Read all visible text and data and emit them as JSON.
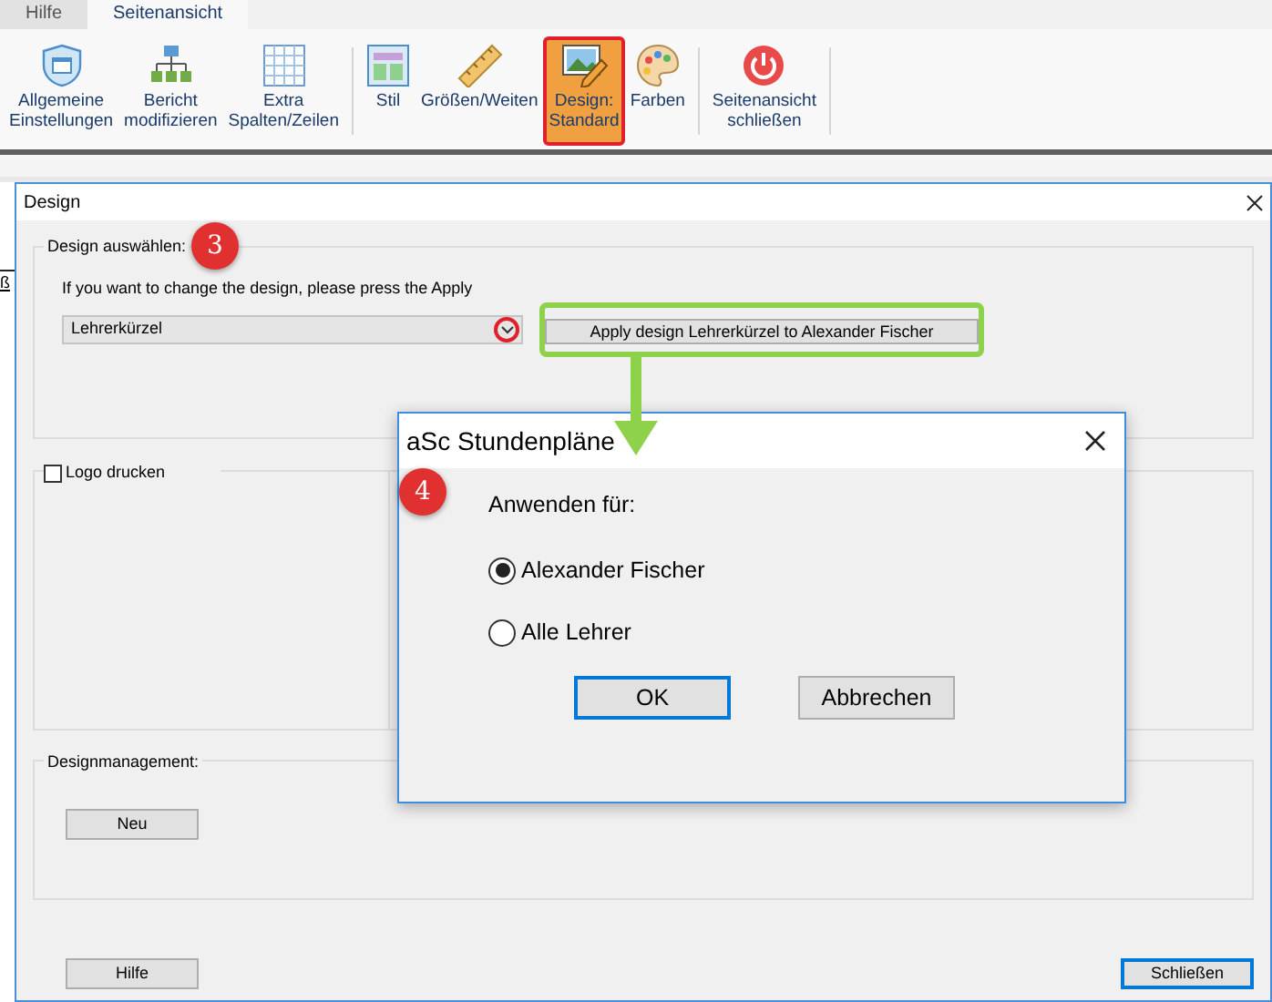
{
  "ribbon": {
    "tabs": [
      {
        "label": "Hilfe",
        "selected": false
      },
      {
        "label": "Seitenansicht",
        "selected": true
      }
    ],
    "groups": [
      [
        {
          "lines": [
            "Allgemeine",
            "Einstellungen"
          ],
          "selected": false
        },
        {
          "lines": [
            "Bericht",
            "modifizieren"
          ],
          "selected": false
        },
        {
          "lines": [
            "Extra",
            "Spalten/Zeilen"
          ],
          "selected": false
        }
      ],
      [
        {
          "lines": [
            "Stil"
          ],
          "selected": false
        },
        {
          "lines": [
            "Größen/Weiten"
          ],
          "selected": false
        },
        {
          "lines": [
            "Design:",
            "Standard"
          ],
          "selected": true
        },
        {
          "lines": [
            "Farben"
          ],
          "selected": false
        }
      ],
      [
        {
          "lines": [
            "Seitenansicht",
            "schließen"
          ],
          "selected": false
        }
      ]
    ]
  },
  "background_fragment": "ß",
  "design_window": {
    "title": "Design",
    "select_group": {
      "label": "Design auswählen:",
      "hint": "If you want to change the design, please press the Apply",
      "dropdown_value": "Lehrerkürzel",
      "apply_button": "Apply design Lehrerkürzel to Alexander Fischer"
    },
    "logo_checkbox": {
      "label": "Logo drucken",
      "checked": false
    },
    "management_group": {
      "label": "Designmanagement:",
      "new_button": "Neu"
    },
    "help_button": "Hilfe",
    "close_button": "Schließen"
  },
  "apply_dialog": {
    "title": "aSc Stundenpläne",
    "prompt": "Anwenden für:",
    "options": [
      {
        "label": "Alexander Fischer",
        "selected": true
      },
      {
        "label": "Alle Lehrer",
        "selected": false
      }
    ],
    "buttons": [
      "OK",
      "Abbrechen"
    ]
  },
  "annotations": [
    {
      "label": "3"
    },
    {
      "label": "4"
    }
  ]
}
